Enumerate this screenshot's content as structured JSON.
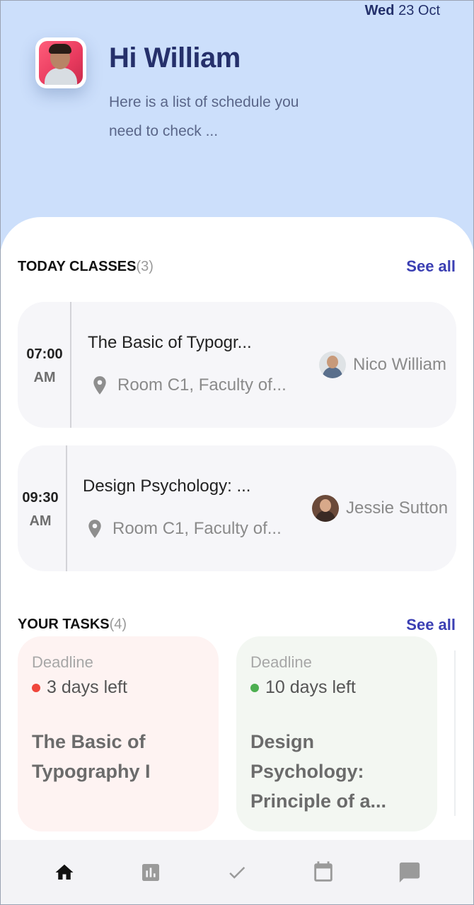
{
  "header": {
    "date_day": "Wed",
    "date_rest": "23 Oct",
    "greeting": "Hi William",
    "subtitle": "Here is a list of schedule you need to check ..."
  },
  "classes": {
    "title": "TODAY CLASSES",
    "count": "(3)",
    "see_all": "See all",
    "items": [
      {
        "time": "07:00",
        "ampm": "AM",
        "title": "The Basic of Typogr...",
        "location": "Room C1, Faculty of...",
        "teacher": "Nico William"
      },
      {
        "time": "09:30",
        "ampm": "AM",
        "title": "Design Psychology: ...",
        "location": "Room C1, Faculty of...",
        "teacher": "Jessie Sutton"
      }
    ]
  },
  "tasks": {
    "title": "YOUR TASKS",
    "count": "(4)",
    "see_all": "See all",
    "items": [
      {
        "label": "Deadline",
        "left": "3 days left",
        "status_color": "#f0463c",
        "title": "The Basic of Typography I",
        "bg": "#fef3f2"
      },
      {
        "label": "Deadline",
        "left": "10 days left",
        "status_color": "#4caf50",
        "title": "Design Psychology: Principle of a...",
        "bg": "#f3f7f2"
      }
    ]
  },
  "nav": {
    "items": [
      "home-icon",
      "chart-icon",
      "check-icon",
      "calendar-icon",
      "chat-icon"
    ],
    "active": "home-icon"
  },
  "colors": {
    "header_bg": "#ccdffb",
    "accent": "#3b3fb3",
    "title_dark": "#25306b"
  }
}
